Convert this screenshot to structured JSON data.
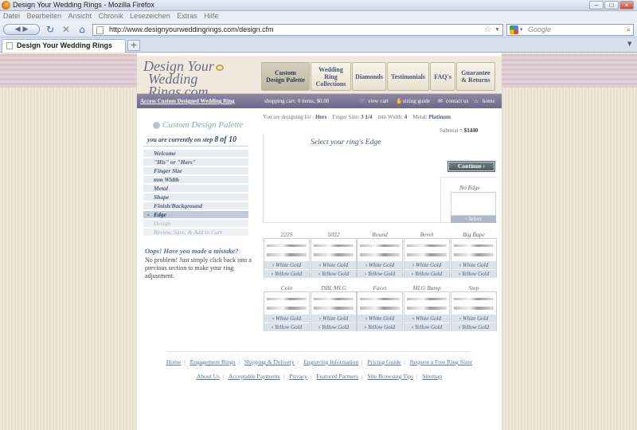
{
  "browser": {
    "title": "Design Your Wedding Rings - Mozilla Firefox",
    "menu": [
      "Datei",
      "Bearbeiten",
      "Ansicht",
      "Chronik",
      "Lesezeichen",
      "Extras",
      "Hilfe"
    ],
    "url": "http://www.designyourweddingrings.com/design.cfm",
    "search_placeholder": "Google",
    "tab_label": "Design Your Wedding Rings",
    "newtab": "+",
    "minimize": "–",
    "maximize": "□",
    "close": "×"
  },
  "site": {
    "logo_line1": "Design Your",
    "logo_line2": "Wedding Rings.com",
    "nav": [
      {
        "l1": "Custom",
        "l2": "Design Palette",
        "active": true
      },
      {
        "l1": "Wedding Ring",
        "l2": "Collections"
      },
      {
        "l1": "Diamonds",
        "l2": ""
      },
      {
        "l1": "Testimonials",
        "l2": ""
      },
      {
        "l1": "FAQ's",
        "l2": ""
      },
      {
        "l1": "Guarantee",
        "l2": "& Returns"
      }
    ],
    "access_link": "Access Custom Designed Wedding Ring",
    "cart": "shopping cart:  0 items, $0.00",
    "view_cart": "view cart",
    "sizing_guide": "sizing guide",
    "contact": "contact us",
    "home": "home"
  },
  "sidebar": {
    "title": "Custom Design Palette",
    "step_prefix": "you are currently on step",
    "step_current": "8",
    "step_of": "of 10",
    "steps": [
      "Welcome",
      "\"His\" or \"Hers\"",
      "Finger Size",
      "mm Width",
      "Metal",
      "Shape",
      "Finish/Background",
      "Edge",
      "Design",
      "Review, Save, & Add to Cart"
    ],
    "oops_title": "Oops! Have you made a mistake?",
    "oops_body": "No problem! Just simply click back into a previous section to make your ring adjustment."
  },
  "design": {
    "designing_for_label": "You are designing for :",
    "designing_for": "Hers",
    "finger_size_label": "Finger Size:",
    "finger_size": "3 1/4",
    "mm_width_label": "mm Width:",
    "mm_width": "4",
    "metal_label": "Metal:",
    "metal": "Platinum",
    "subtotal_label": "Subtotal =",
    "subtotal": "$1440",
    "edge_header": "Select your ring's Edge",
    "continue": "Continue ›",
    "no_edge": "No Edge",
    "select": "› Select",
    "white_gold": "White Gold",
    "yellow_gold": "Yellow Gold",
    "edges_row1": [
      "222S",
      "5032",
      "Round",
      "Bevel",
      "Big Bape"
    ],
    "edges_row2": [
      "Coin",
      "DBL MLG",
      "Facet",
      "MLG Bump",
      "Step"
    ]
  },
  "footer": {
    "row1": [
      "Home",
      "Engagement Rings",
      "Shipping & Delivery",
      "Engraving Information",
      "Pricing Guide",
      "Request a Free Ring Sizer"
    ],
    "row2": [
      "About Us",
      "Acceptable Payments",
      "Privacy",
      "Featured Partners",
      "Site Browsing Tips",
      "Sitemap"
    ]
  }
}
